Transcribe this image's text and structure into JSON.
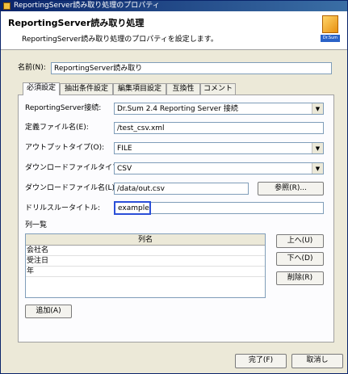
{
  "window": {
    "title": "ReportingServer読み取り処理のプロパティ"
  },
  "header": {
    "title": "ReportingServer読み取り処理",
    "subtitle": "ReportingServer読み取り処理のプロパティを設定します。",
    "logo_text": "Dr.Sum"
  },
  "name_field": {
    "label": "名前(N):",
    "value": "ReportingServer読み取り"
  },
  "tabs": [
    {
      "label": "必須設定"
    },
    {
      "label": "抽出条件設定"
    },
    {
      "label": "編集項目設定"
    },
    {
      "label": "互換性"
    },
    {
      "label": "コメント"
    }
  ],
  "form": {
    "connection": {
      "label": "ReportingServer接続:",
      "value": "Dr.Sum 2.4 Reporting Server 接続"
    },
    "definition_file": {
      "label": "定義ファイル名(E):",
      "value": "/test_csv.xml"
    },
    "output_type": {
      "label": "アウトプットタイプ(O):",
      "value": "FILE"
    },
    "download_file_type": {
      "label": "ダウンロードファイルタイプ(T):",
      "value": "CSV"
    },
    "download_file_name": {
      "label": "ダウンロードファイル名(L):",
      "value": "/data/out.csv",
      "browse_label": "参照(R)..."
    },
    "drillthrough_title": {
      "label": "ドリルスルータイトル:",
      "value": "example"
    }
  },
  "column_list": {
    "label": "列一覧",
    "header": "列名",
    "rows": [
      "会社名",
      "受注日",
      "年"
    ],
    "up_label": "上へ(U)",
    "down_label": "下へ(D)",
    "delete_label": "削除(R)",
    "add_label": "追加(A)"
  },
  "footer": {
    "ok_label": "完了(F)",
    "cancel_label": "取消し"
  }
}
